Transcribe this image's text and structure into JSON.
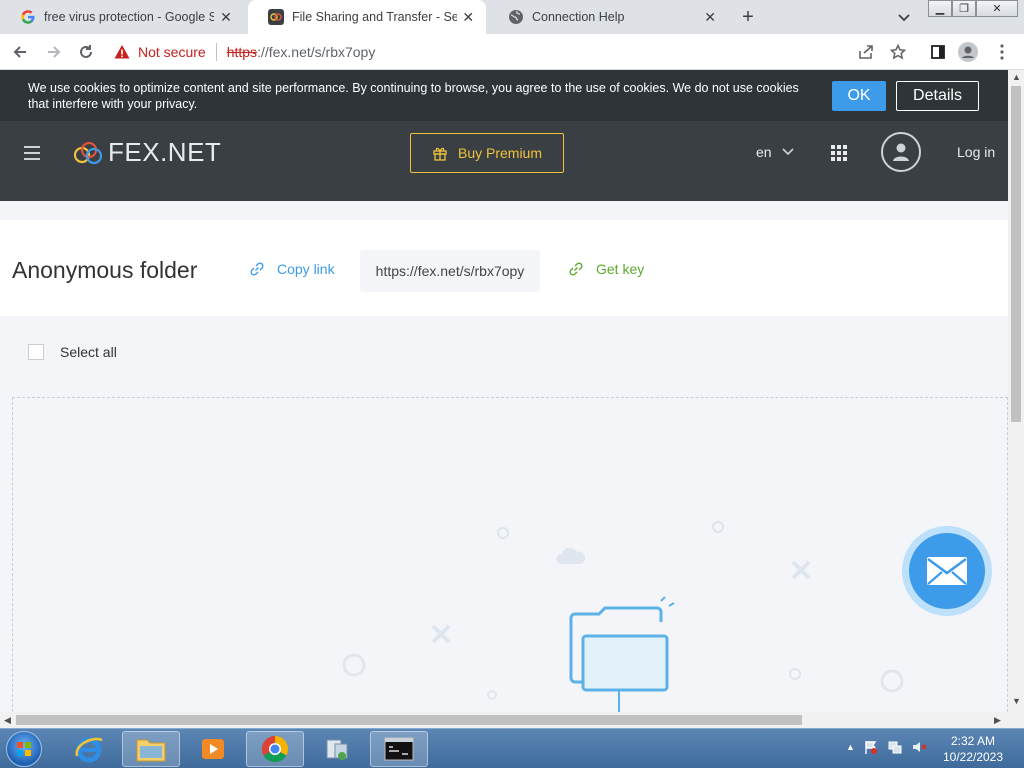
{
  "browser": {
    "tabs": [
      {
        "title": "free virus protection - Google Se",
        "favicon": "google-g-icon",
        "active": false
      },
      {
        "title": "File Sharing and Transfer - Send l",
        "favicon": "fex-favicon-icon",
        "active": true
      },
      {
        "title": "Connection Help",
        "favicon": "globe-icon",
        "active": false
      }
    ],
    "new_tab_label": "+",
    "security_label": "Not secure",
    "url_scheme": "https",
    "url_rest": "://fex.net/s/rbx7opy"
  },
  "cookie_banner": {
    "text": "We use cookies to optimize content and site performance. By continuing to browse, you agree to the use of cookies. We do not use cookies that interfere with your privacy.",
    "ok_label": "OK",
    "details_label": "Details"
  },
  "header": {
    "logo_text": "FEX.NET",
    "premium_label": "Buy Premium",
    "language": "en",
    "login_label": "Log in"
  },
  "folder": {
    "title": "Anonymous folder",
    "copy_link_label": "Copy link",
    "share_url": "https://fex.net/s/rbx7opy",
    "get_key_label": "Get key",
    "select_all_label": "Select all"
  },
  "taskbar": {
    "time": "2:32 AM",
    "date": "10/22/2023"
  },
  "colors": {
    "accent": "#3d9be9",
    "premium": "#f0c23b",
    "header_bg": "#3a3f44",
    "key_green": "#5daa2e"
  }
}
